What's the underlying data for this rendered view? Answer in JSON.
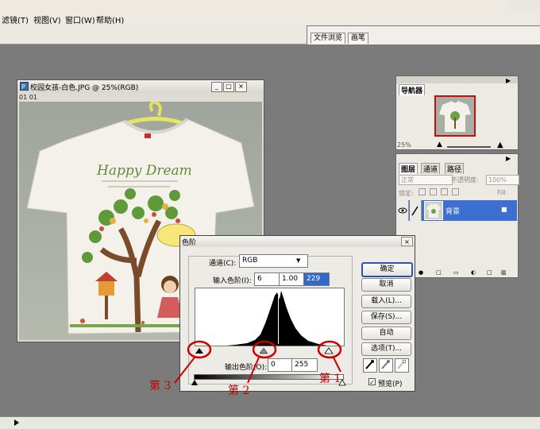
{
  "menu": [
    "滤镜(T)",
    "视图(V)",
    "窗口(W)",
    "帮助(H)"
  ],
  "palette_well": {
    "tabs": [
      "文件浏览",
      "画笔"
    ]
  },
  "document": {
    "title": "校园女孩-白色.JPG @ 25%(RGB)",
    "status": "01 01",
    "shirt_text": "Happy Dream"
  },
  "navigator": {
    "tab": "导航器",
    "zoom": "25%"
  },
  "layers": {
    "tabs": [
      "图层",
      "通道",
      "路径"
    ],
    "blend_mode": "正常",
    "opacity_label": "不透明度:",
    "opacity_value": "100%",
    "lock_label": "锁定:",
    "fill_label": "Fill:",
    "fill_value": "100%",
    "layer_name": "背景"
  },
  "levels": {
    "title": "色阶",
    "channel_label": "通道(C):",
    "channel_value": "RGB",
    "input_label": "输入色阶(I):",
    "input_values": [
      "6",
      "1.00",
      "229"
    ],
    "output_label": "输出色阶(O):",
    "output_values": [
      "0",
      "255"
    ],
    "buttons": [
      "确定",
      "取消",
      "载入(L)...",
      "保存(S)...",
      "自动",
      "选项(T)..."
    ],
    "preview_label": "预览(P)",
    "preview_checked": "✓"
  },
  "annotations": [
    "第 1",
    "第 2",
    "第 3"
  ],
  "colors": {
    "annotation": "#cc0000",
    "selection": "#3d6fd0"
  }
}
